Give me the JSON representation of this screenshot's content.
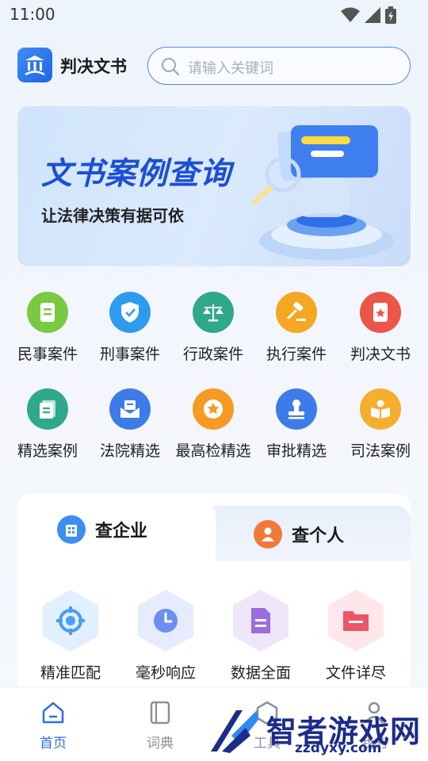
{
  "status_bar": {
    "time": "11:00",
    "icons": [
      "wifi-icon",
      "signal-icon",
      "battery-icon"
    ]
  },
  "header": {
    "app_title": "判决文书",
    "search_placeholder": "请输入关键词"
  },
  "banner": {
    "title": "文书案例查询",
    "subtitle": "让法律决策有据可依"
  },
  "categories": [
    {
      "label": "民事案件",
      "icon": "document-icon",
      "color": "#7ac943"
    },
    {
      "label": "刑事案件",
      "icon": "shield-check-icon",
      "color": "#2d9cf0"
    },
    {
      "label": "行政案件",
      "icon": "scale-icon",
      "color": "#2fa88c"
    },
    {
      "label": "执行案件",
      "icon": "gavel-icon",
      "color": "#f5a623"
    },
    {
      "label": "判决文书",
      "icon": "star-card-icon",
      "color": "#ec5548"
    },
    {
      "label": "精选案例",
      "icon": "file-stack-icon",
      "color": "#2fa88c"
    },
    {
      "label": "法院精选",
      "icon": "mail-icon",
      "color": "#3d7be8"
    },
    {
      "label": "最高检精选",
      "icon": "star-badge-icon",
      "color": "#f59a23"
    },
    {
      "label": "审批精选",
      "icon": "stamp-icon",
      "color": "#3d7be8"
    },
    {
      "label": "司法案例",
      "icon": "book-user-icon",
      "color": "#f5ae2e"
    }
  ],
  "tabs": {
    "company": {
      "label": "查企业",
      "color": "#3d8ef0"
    },
    "person": {
      "label": "查个人",
      "color": "#f07a3a"
    }
  },
  "features": [
    {
      "label": "精准匹配",
      "icon": "target-icon",
      "color": "#4a9ef0"
    },
    {
      "label": "毫秒响应",
      "icon": "clock-icon",
      "color": "#6d8ff0"
    },
    {
      "label": "数据全面",
      "icon": "document-icon",
      "color": "#9b6de0"
    },
    {
      "label": "文件详尽",
      "icon": "folder-icon",
      "color": "#ec5566"
    }
  ],
  "nav": [
    {
      "label": "首页",
      "icon": "home-icon",
      "active": true
    },
    {
      "label": "词典",
      "icon": "book-icon",
      "active": false
    },
    {
      "label": "工具",
      "icon": "toolbox-icon",
      "active": false
    },
    {
      "label": "我的",
      "icon": "user-icon",
      "active": false
    }
  ],
  "watermark": {
    "text": "智者游戏网",
    "url": "zzdyxy.com"
  }
}
